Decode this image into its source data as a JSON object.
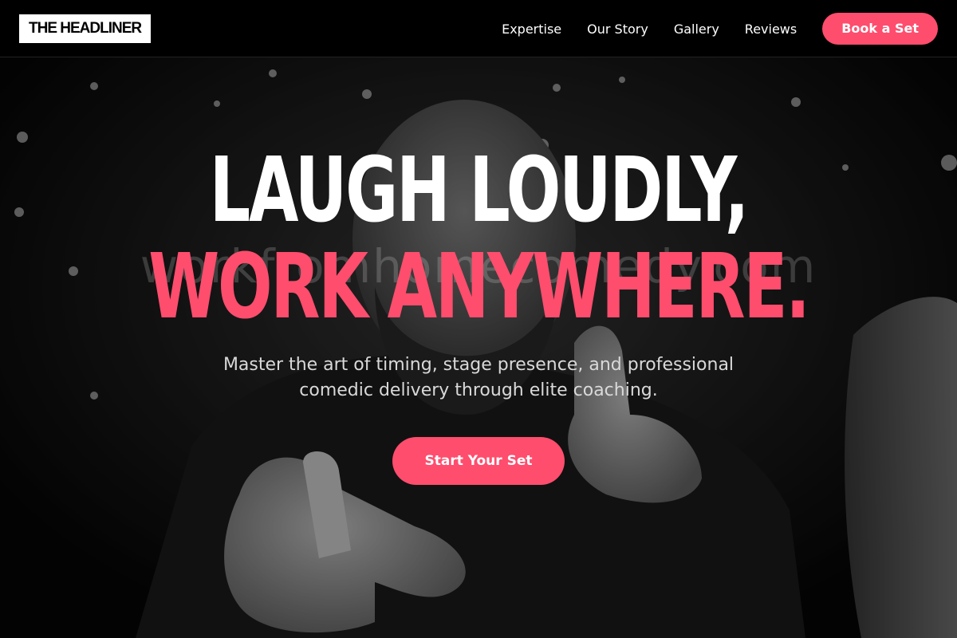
{
  "header": {
    "logo_text": "THE HEADLINER",
    "nav": [
      {
        "label": "Expertise"
      },
      {
        "label": "Our Story"
      },
      {
        "label": "Gallery"
      },
      {
        "label": "Reviews"
      }
    ],
    "cta_label": "Book a Set"
  },
  "hero": {
    "headline_line1": "LAUGH LOUDLY,",
    "headline_line2": "WORK ANYWHERE.",
    "watermark": "workfromhomecomedy.com",
    "subtitle": "Master the art of timing, stage presence, and professional comedic delivery through elite coaching.",
    "cta_label": "Start Your Set",
    "image_description_icon": "comedian-pointing-photo"
  },
  "colors": {
    "accent": "#ff4d6d",
    "header_bg": "#000000",
    "text_light": "#ffffff"
  }
}
